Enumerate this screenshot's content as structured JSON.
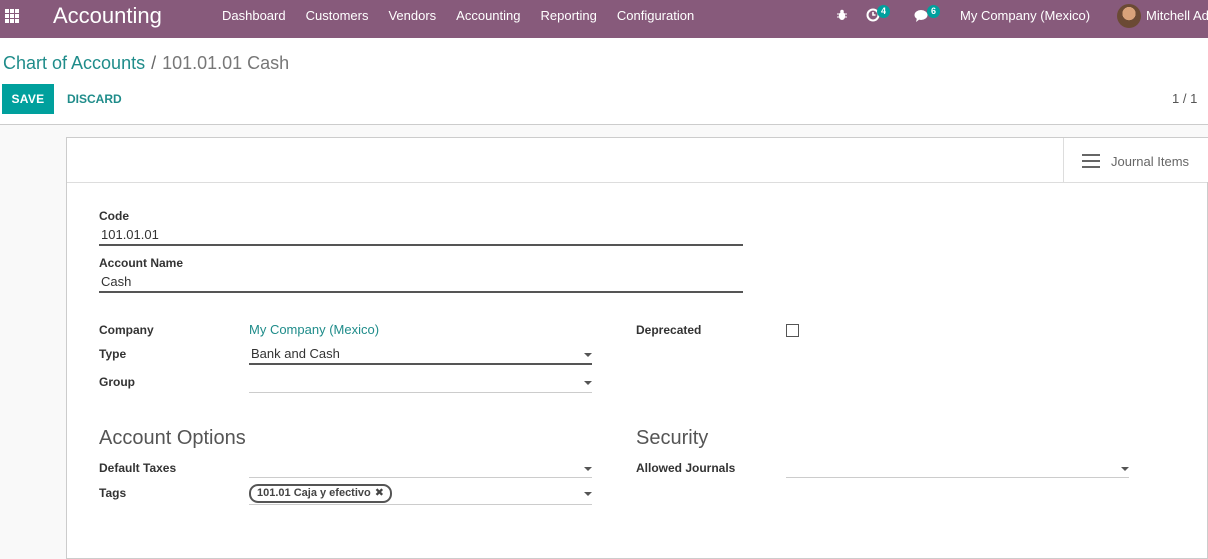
{
  "app": {
    "brand": "Accounting",
    "menu": [
      "Dashboard",
      "Customers",
      "Vendors",
      "Accounting",
      "Reporting",
      "Configuration"
    ],
    "activity_count": "4",
    "message_count": "6",
    "company": "My Company (Mexico)",
    "user": "Mitchell Ad"
  },
  "control": {
    "breadcrumb_parent": "Chart of Accounts",
    "breadcrumb_separator": "/",
    "breadcrumb_current": "101.01.01 Cash",
    "save_label": "SAVE",
    "discard_label": "DISCARD",
    "pager": "1 / 1"
  },
  "form": {
    "smart_button": "Journal Items",
    "code_label": "Code",
    "code_value": "101.01.01",
    "name_label": "Account Name",
    "name_value": "Cash",
    "company_label": "Company",
    "company_value": "My Company (Mexico)",
    "type_label": "Type",
    "type_value": "Bank and Cash",
    "group_label": "Group",
    "group_value": "",
    "deprecated_label": "Deprecated",
    "deprecated_checked": false,
    "options_title": "Account Options",
    "default_taxes_label": "Default Taxes",
    "tags_label": "Tags",
    "tags": [
      "101.01 Caja y efectivo"
    ],
    "security_title": "Security",
    "allowed_journals_label": "Allowed Journals"
  },
  "colors": {
    "navbar": "#875a7b",
    "primary": "#00a09d",
    "link": "#1f8c8a"
  }
}
